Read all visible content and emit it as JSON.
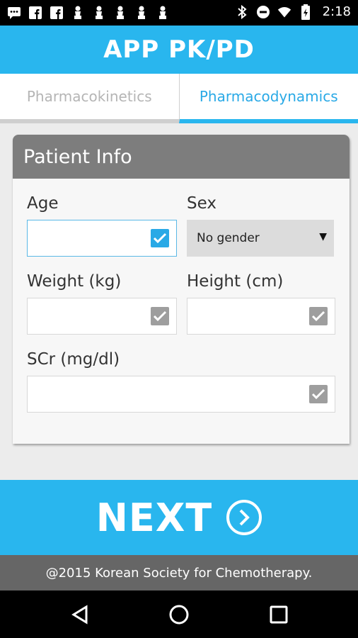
{
  "status_bar": {
    "time": "2:18",
    "left_icons": [
      "message-icon",
      "facebook-icon",
      "facebook-icon",
      "figure-icon",
      "figure-icon",
      "figure-icon",
      "figure-icon",
      "figure-icon"
    ],
    "right_icons": [
      "bluetooth-icon",
      "do-not-disturb-icon",
      "wifi-icon",
      "battery-icon"
    ]
  },
  "app_bar": {
    "title": "APP PK/PD"
  },
  "tabs": [
    {
      "label": "Pharmacokinetics",
      "selected": false
    },
    {
      "label": "Pharmacodynamics",
      "selected": true
    }
  ],
  "card": {
    "title": "Patient Info",
    "fields": {
      "age": {
        "label": "Age",
        "value": ""
      },
      "sex": {
        "label": "Sex",
        "selected": "No gender"
      },
      "weight": {
        "label": "Weight (kg)",
        "value": ""
      },
      "height": {
        "label": "Height (cm)",
        "value": ""
      },
      "scr": {
        "label": "SCr (mg/dl)",
        "value": ""
      }
    }
  },
  "next_button": {
    "label": "NEXT"
  },
  "footer": {
    "text": "@2015 Korean Society for Chemotherapy."
  },
  "colors": {
    "accent": "#29b6ee",
    "header_gray": "#7d7d7d",
    "footer_gray": "#666666"
  }
}
